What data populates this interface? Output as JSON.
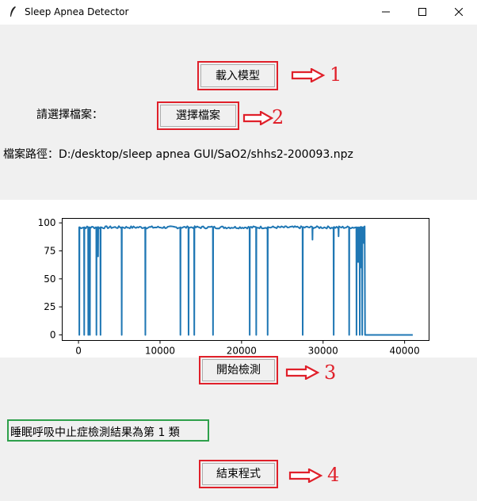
{
  "window": {
    "title": "Sleep Apnea Detector"
  },
  "buttons": {
    "load_model": "載入模型",
    "select_file": "選擇檔案",
    "start_detect": "開始檢測",
    "exit": "結束程式"
  },
  "labels": {
    "select_prompt": "請選擇檔案：",
    "file_path": "檔案路徑：D:/desktop/sleep apnea GUI/SaO2/shhs2-200093.npz",
    "result": "睡眠呼吸中止症檢測結果為第 1 類"
  },
  "annotations": [
    "1",
    "2",
    "3",
    "4"
  ],
  "colors": {
    "line": "#1f77b4",
    "annotation": "#e0202a",
    "result_box": "#2ea04b"
  },
  "chart_data": {
    "type": "line",
    "xlim": [
      -2000,
      43000
    ],
    "ylim": [
      -5,
      104
    ],
    "x_ticks": [
      "0",
      "10000",
      "20000",
      "30000",
      "40000"
    ],
    "y_ticks": [
      "0",
      "25",
      "50",
      "75",
      "100"
    ],
    "baseline": 96,
    "signal_end_x": 35100,
    "series_end_x": 41000,
    "deep_drops_x": [
      100,
      700,
      1200,
      1400,
      2200,
      2700,
      5300,
      8200,
      12500,
      13500,
      14200,
      16500,
      21000,
      21800,
      23200,
      27500,
      31300,
      33200,
      34100,
      34500,
      34800
    ],
    "partial_drops": [
      [
        2400,
        70
      ],
      [
        28700,
        85
      ],
      [
        31900,
        88
      ],
      [
        34300,
        65
      ],
      [
        34700,
        60
      ],
      [
        35000,
        82
      ]
    ],
    "grid": false
  }
}
